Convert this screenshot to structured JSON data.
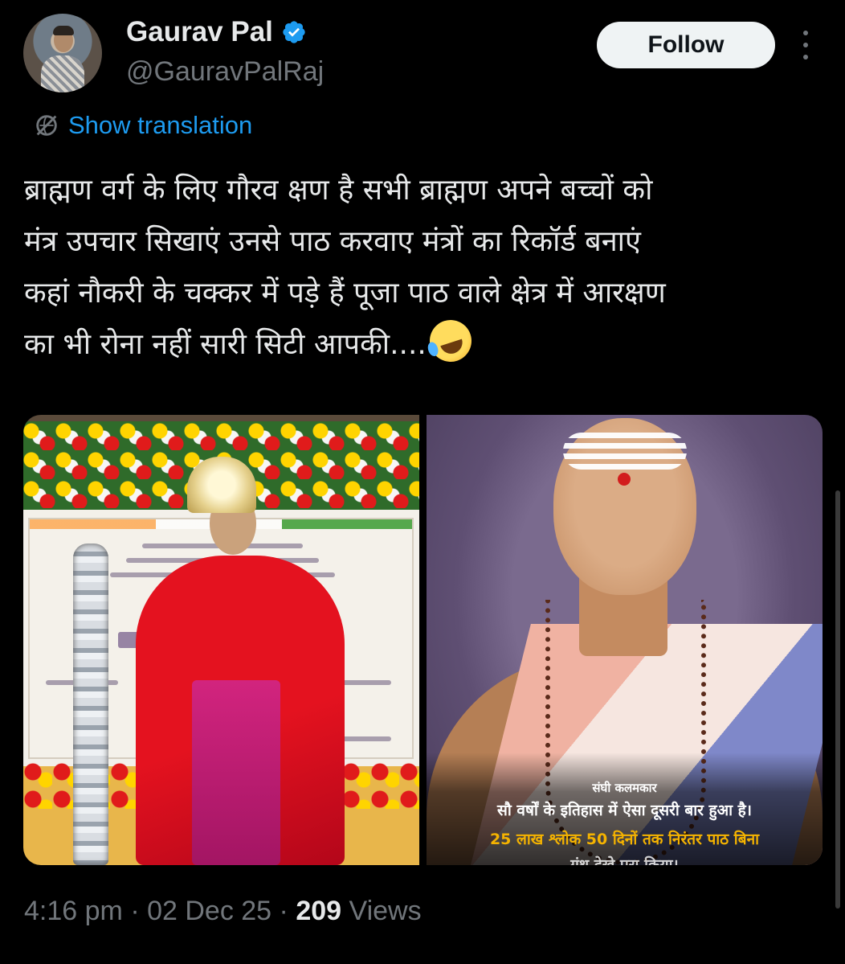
{
  "author": {
    "name": "Gaurav Pal",
    "handle": "@GauravPalRaj",
    "verified": true
  },
  "actions": {
    "follow_label": "Follow",
    "more_icon": "more-vertical-icon"
  },
  "translation": {
    "label": "Show translation",
    "icon": "globe-translate-icon"
  },
  "tweet": {
    "lines": [
      "ब्राह्मण वर्ग के लिए गौरव क्षण है सभी ब्राह्मण अपने बच्चों को",
      "मंत्र उपचार सिखाएं उनसे पाठ करवाए मंत्रों का रिकॉर्ड बनाएं",
      "कहां नौकरी के चक्कर में पड़े हैं पूजा पाठ वाले क्षेत्र में आरक्षण",
      "का भी रोना नहीं सारी सिटी आपकी...."
    ],
    "emoji": "rolling-on-floor-laughing-emoji"
  },
  "media": {
    "right_caption": {
      "brand": "संघी कलमकार",
      "line1": "सौ वर्षों के इतिहास में ऐसा दूसरी बार हुआ है।",
      "line2": "25 लाख श्लोक 50 दिनों तक निरंतर पाठ बिना",
      "line3": "ग्रंथ देखे पूरा किया।"
    }
  },
  "meta": {
    "time": "4:16 pm",
    "separator": "·",
    "date": "02 Dec 25",
    "views_count": "209",
    "views_label": "Views"
  },
  "colors": {
    "background": "#000000",
    "text": "#e7e9ea",
    "muted": "#71767b",
    "link": "#1d9bf0",
    "verified": "#1d9bf0",
    "caption_highlight": "#f5b300"
  }
}
